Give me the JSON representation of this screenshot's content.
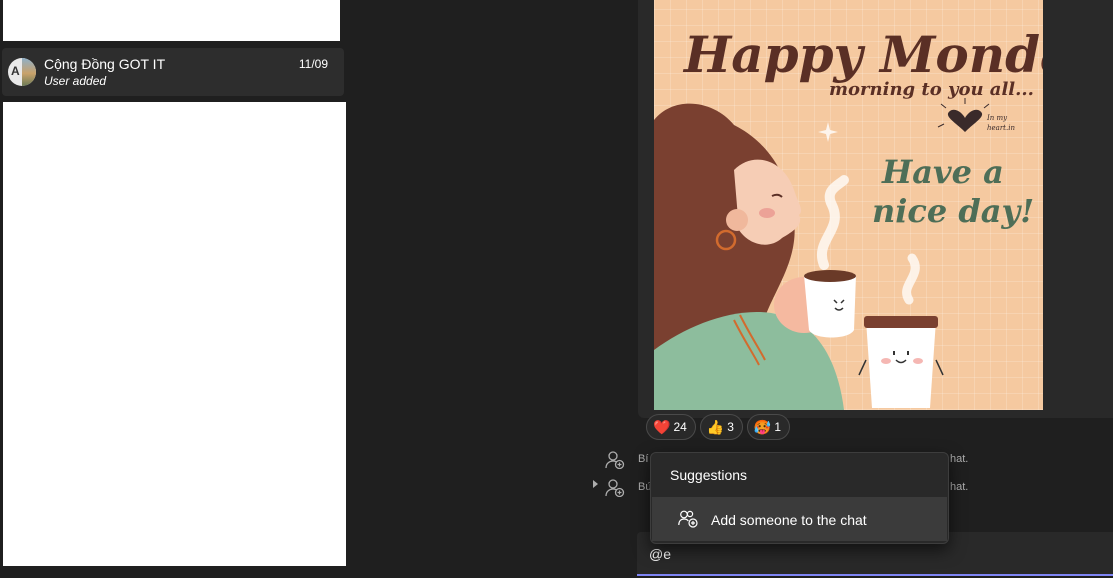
{
  "chat_list": {
    "item": {
      "avatar_letter": "A",
      "name": "Cộng Đồng GOT IT",
      "date": "11/09",
      "preview": "User added"
    }
  },
  "message": {
    "poster": {
      "title": "Happy Monday",
      "subtitle": "morning to you all...",
      "heart_caption_1": "In my",
      "heart_caption_2": "heart.in",
      "tagline_1": "Have a",
      "tagline_2": "nice day!"
    },
    "reactions": [
      {
        "icon": "heart",
        "emoji": "❤️",
        "count": "24"
      },
      {
        "icon": "thumbs-up",
        "emoji": "👍",
        "count": "3"
      },
      {
        "icon": "hot-face",
        "emoji": "🥵",
        "count": "1"
      }
    ]
  },
  "system_messages": [
    {
      "prefix": "Bí",
      "suffix": "hat."
    },
    {
      "prefix": "Bứ",
      "suffix": "hat."
    }
  ],
  "suggestions": {
    "title": "Suggestions",
    "item_label": "Add someone to the chat"
  },
  "compose": {
    "value": "@e",
    "accent_color": "#7f85f5"
  }
}
